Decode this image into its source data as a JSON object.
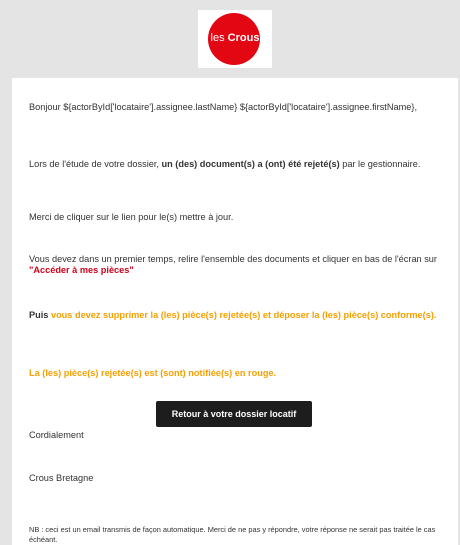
{
  "brand": {
    "logo_prefix": "les ",
    "logo_name": "Crous",
    "logo_color": "#e30613"
  },
  "email": {
    "greeting": "Bonjour ${actorById['locataire'].assignee.lastName} ${actorById['locataire'].assignee.firstName},",
    "p1_before": "Lors de l'étude de votre dossier, ",
    "p1_bold": "un (des) document(s) a (ont) été rejeté(s)",
    "p1_after": " par le gestionnaire.",
    "p2": "Merci de cliquer sur le lien pour le(s) mettre à jour.",
    "p3_before": "Vous devez dans un premier temps, relire l'ensemble des documents et cliquer en bas de l'écran sur ",
    "p3_link": "\"Accéder à mes pièces\"",
    "p4_bold": "Puis",
    "p4_orange": " vous devez supprimer la (les) pièce(s) rejetée(s) et déposer la (les) pièce(s) conforme(s).",
    "p5": "La (les) pièce(s) rejetée(s) est (sont) notifiée(s) en rouge.",
    "cta_label": "Retour à votre dossier locatif",
    "closing": "Cordialement",
    "signature": "Crous Bretagne",
    "nb": "NB : ceci est un email transmis de façon automatique. Merci de ne pas y répondre, votre réponse ne serait pas traitée le cas échéant."
  },
  "colors": {
    "red": "#d0021b",
    "orange": "#f5a000",
    "button_bg": "#1d1d1d",
    "header_bg": "#e4e4e4"
  }
}
